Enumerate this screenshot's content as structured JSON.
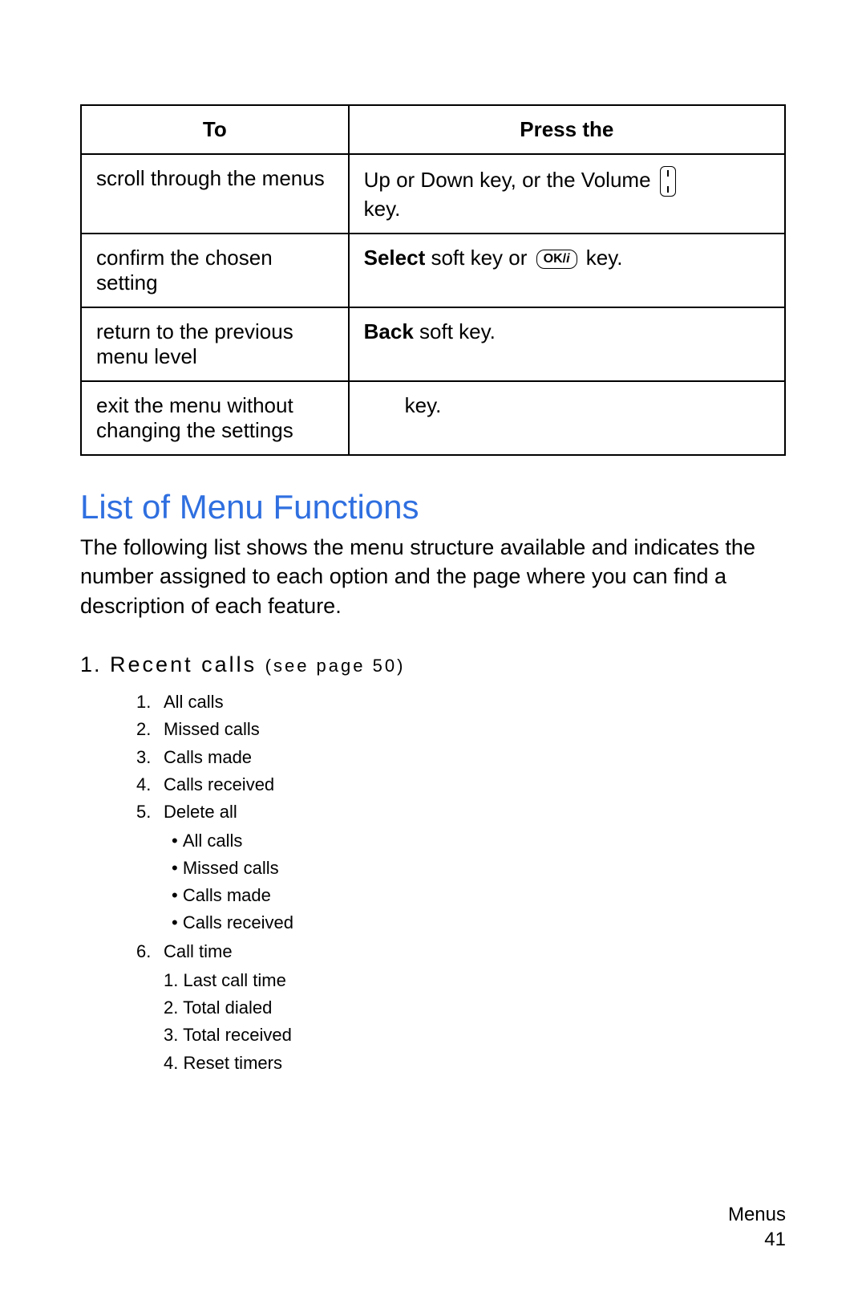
{
  "table": {
    "headers": {
      "to": "To",
      "press": "Press the"
    },
    "rows": [
      {
        "to": "scroll through the menus",
        "press_prefix": "Up or Down key, or the Volume ",
        "press_suffix": "key."
      },
      {
        "to": "confirm the chosen setting",
        "bold": "Select",
        "mid": " soft key or ",
        "ok_label": "OK/",
        "ok_slash": "i",
        "tail": " key."
      },
      {
        "to": "return to the previous menu level",
        "bold": "Back",
        "tail": " soft key."
      },
      {
        "to": "exit the menu without changing the settings",
        "tail": "key."
      }
    ]
  },
  "section": {
    "title": "List of Menu Functions",
    "intro": "The following list shows the menu structure available and indicates the number assigned to each option and the page where you can find a description of each feature."
  },
  "menu": {
    "num": "1.",
    "title": "Recent calls",
    "see": "(see page 50)",
    "items": [
      "All calls",
      "Missed calls",
      "Calls made",
      "Calls received",
      "Delete all",
      "Call time"
    ],
    "deleteAll": [
      "All calls",
      "Missed calls",
      "Calls made",
      "Calls received"
    ],
    "callTime": [
      "Last call time",
      "Total dialed",
      "Total received",
      "Reset timers"
    ]
  },
  "footer": {
    "section": "Menus",
    "page": "41"
  }
}
